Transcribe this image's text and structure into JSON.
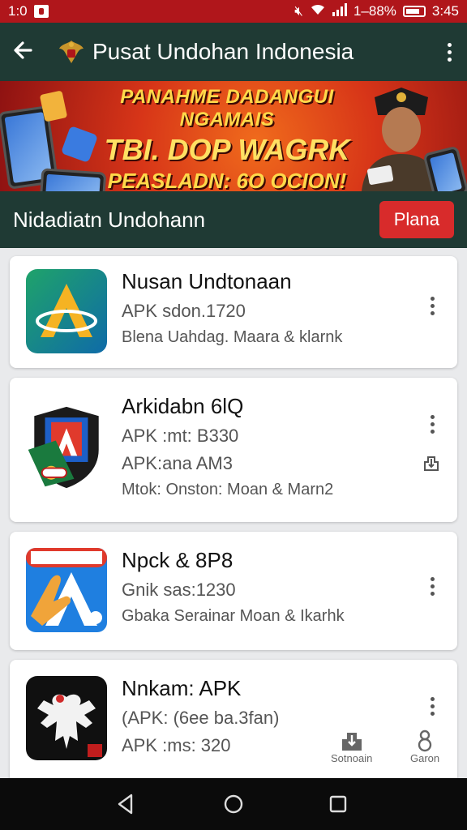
{
  "status": {
    "time": "1:0",
    "battery": "1–88%",
    "clock": "3:45"
  },
  "appbar": {
    "title": "Pusat Undohan Indonesia"
  },
  "banner": {
    "line1": "PANAHME DADANGUI NGAMAIS",
    "line2": "TBI. DOP WAGRK",
    "line3": "PEASLADN: 6O OCION!"
  },
  "section": {
    "title": "Nidadiatn Undohann",
    "button": "Plana"
  },
  "apps": [
    {
      "name": "Nusan Undtonaan",
      "lines": [
        "APK sdon.1720",
        "Blena Uahdag. Maara & klarnk"
      ]
    },
    {
      "name": "Arkidabn 6lQ",
      "lines": [
        "APK :mt: B330",
        "APK:ana AM3",
        "Mtok: Onston: Moan & Marn2"
      ]
    },
    {
      "name": "Npck & 8P8",
      "lines": [
        "Gnik sas:1230",
        "Gbaka Serainar Moan & Ikarhk"
      ]
    },
    {
      "name": "Nnkam: APK",
      "lines": [
        "(APK: (6ee ba.3fan)",
        "APK :ms: 320"
      ]
    }
  ],
  "bottom_actions": [
    {
      "label": "Sotnoain",
      "icon": "download-icon"
    },
    {
      "label": "Garon",
      "icon": "person-icon"
    }
  ],
  "colors": {
    "statusbar": "#b0161b",
    "appbar": "#1f3a34",
    "accent": "#d82b2b"
  }
}
